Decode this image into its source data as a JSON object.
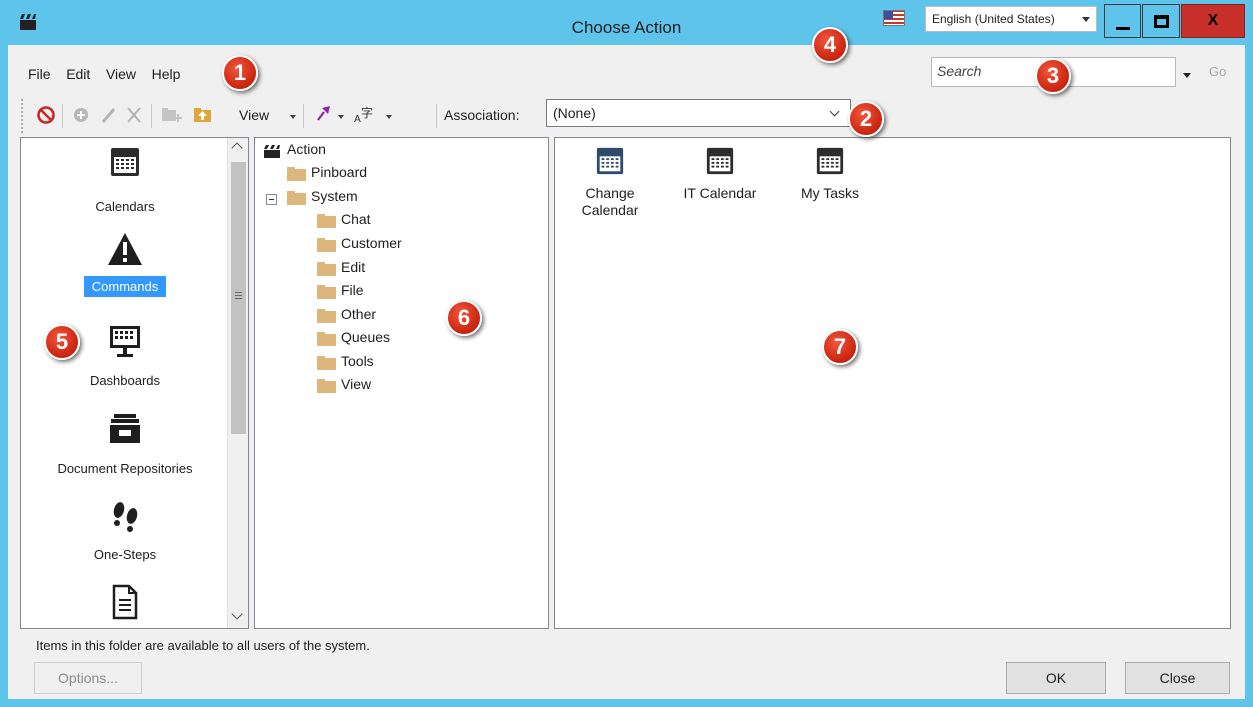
{
  "window": {
    "title": "Choose Action",
    "language": "English (United States)",
    "close_label": "X"
  },
  "menu": [
    "File",
    "Edit",
    "View",
    "Help"
  ],
  "search": {
    "placeholder": "Search",
    "go_label": "Go"
  },
  "toolbar": {
    "view_label": "View",
    "association_label": "Association:",
    "association_value": "(None)"
  },
  "categories": [
    {
      "label": "Calendars",
      "icon": "calendar-icon"
    },
    {
      "label": "Commands",
      "icon": "warning-icon",
      "selected": true
    },
    {
      "label": "Dashboards",
      "icon": "dashboard-icon"
    },
    {
      "label": "Document Repositories",
      "icon": "file-cabinet-icon"
    },
    {
      "label": "One-Steps",
      "icon": "footprints-icon"
    },
    {
      "label": "",
      "icon": "document-icon"
    }
  ],
  "tree": {
    "root": "Action",
    "nodes": [
      "Pinboard",
      "System",
      "Chat",
      "Customer",
      "Edit",
      "File",
      "Other",
      "Queues",
      "Tools",
      "View"
    ]
  },
  "actions": [
    {
      "label": "Change\nCalendar",
      "icon": "calendar-icon"
    },
    {
      "label": "IT Calendar",
      "icon": "calendar-icon"
    },
    {
      "label": "My Tasks",
      "icon": "calendar-icon"
    }
  ],
  "badges": [
    "1",
    "2",
    "3",
    "4",
    "5",
    "6",
    "7"
  ],
  "status": "Items in this folder are available to all users of the system.",
  "buttons": {
    "options": "Options...",
    "ok": "OK",
    "close": "Close"
  },
  "colors": {
    "title_bar": "#5ec4ec",
    "selection": "#3399ff",
    "badge": "#d9301a",
    "close_button": "#c7302a"
  }
}
